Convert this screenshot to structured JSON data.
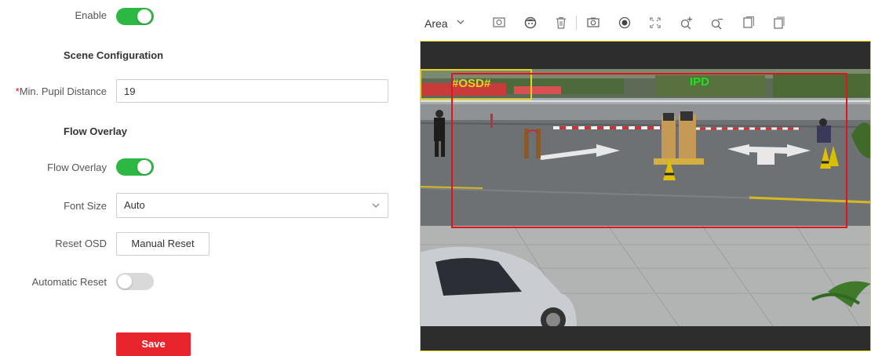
{
  "form": {
    "enable_label": "Enable",
    "enable_state": "on",
    "scene_section_title": "Scene Configuration",
    "min_pupil_label": "Min. Pupil Distance",
    "min_pupil_required_mark": "*",
    "min_pupil_value": "19",
    "flow_section_title": "Flow Overlay",
    "flow_overlay_label": "Flow Overlay",
    "flow_overlay_state": "on",
    "font_size_label": "Font Size",
    "font_size_value": "Auto",
    "reset_osd_label": "Reset OSD",
    "manual_reset_button": "Manual Reset",
    "automatic_reset_label": "Automatic Reset",
    "automatic_reset_state": "off",
    "save_button": "Save"
  },
  "toolbar": {
    "area_label": "Area",
    "tools": [
      "draw-area-icon",
      "face-icon",
      "delete-icon",
      "capture-icon",
      "record-icon",
      "fullscreen-icon",
      "zoom-in-icon",
      "zoom-out-icon",
      "copy-icon",
      "paste-icon"
    ]
  },
  "video": {
    "osd_label": "#OSD#",
    "ipd_label": "IPD"
  },
  "colors": {
    "toggle_on": "#2db843",
    "toggle_off": "#d9d9d9",
    "save_button": "#e8242c",
    "detection_box": "#e0141e",
    "osd_box": "#e6d21a",
    "ipd_text": "#20e020",
    "selection_outline": "#e6d21a"
  }
}
